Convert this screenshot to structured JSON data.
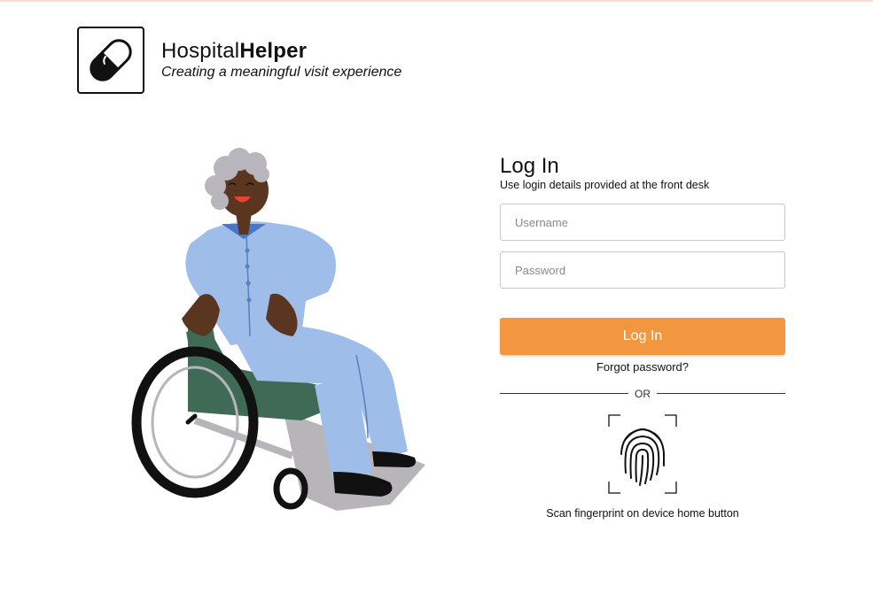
{
  "brand": {
    "name_light": "Hospital",
    "name_bold": "Helper",
    "tagline": "Creating a meaningful visit experience",
    "logo_icon": "pill-icon"
  },
  "illustration": {
    "description_icon": "patient-in-wheelchair-illustration"
  },
  "login": {
    "title": "Log In",
    "subtitle": "Use login details provided at the front desk",
    "username_placeholder": "Username",
    "password_placeholder": "Password",
    "submit_label": "Log In",
    "forgot_password": "Forgot password?",
    "divider_text": "OR",
    "fingerprint_icon": "fingerprint-icon",
    "fingerprint_caption": "Scan fingerprint on device home button"
  },
  "colors": {
    "accent": "#f2973f",
    "shirt": "#9fbde9",
    "skin": "#5a3520",
    "hair": "#b8b6bc",
    "seat": "#3f6b56"
  }
}
